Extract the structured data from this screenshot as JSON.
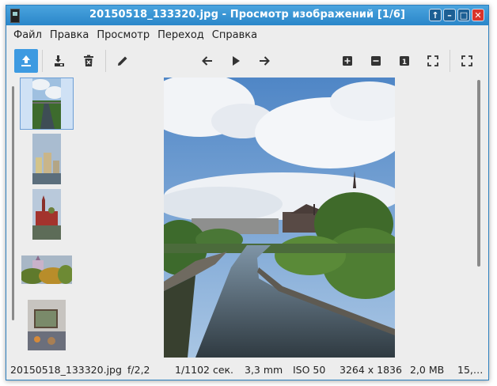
{
  "window": {
    "title": "20150518_133320.jpg - Просмотр изображений [1/6]",
    "buttons": {
      "up": "↑",
      "minimize": "–",
      "maximize": "□",
      "close": "✕"
    }
  },
  "menu": [
    "Файл",
    "Правка",
    "Просмотр",
    "Переход",
    "Справка"
  ],
  "toolbar": {
    "icons": [
      "upload-icon",
      "save-icon",
      "trash-icon",
      "pencil-icon",
      "arrow-left-icon",
      "play-icon",
      "arrow-right-icon",
      "zoom-in-icon",
      "zoom-out-icon",
      "actual-size-icon",
      "fit-icon",
      "fullscreen-icon"
    ],
    "actual_size_label": "1"
  },
  "thumbnails": {
    "count": 5,
    "selected_index": 0
  },
  "status": {
    "filename": "20150518_133320.jpg",
    "aperture": "f/2,2",
    "shutter": "1/1102 сек.",
    "focal": "3,3 mm",
    "iso": "ISO 50",
    "dimensions": "3264 x 1836",
    "size": "2,0 MB",
    "extra": "15,…"
  },
  "colors": {
    "accent": "#3d9ae1",
    "titlebar": "#2a86c9",
    "close": "#d9342b"
  }
}
